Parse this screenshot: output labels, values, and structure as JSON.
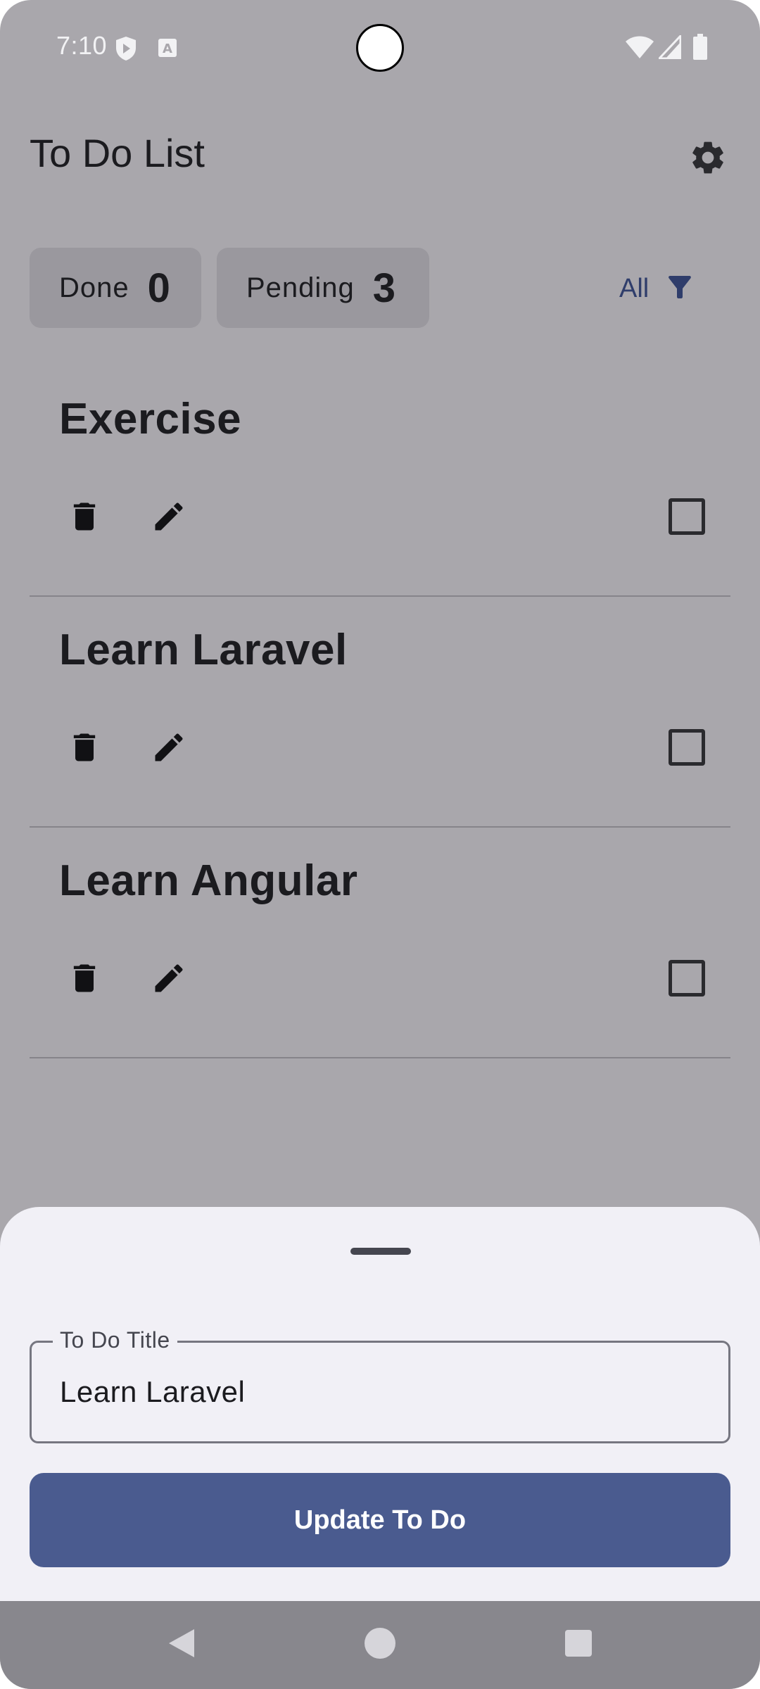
{
  "status_bar": {
    "time": "7:10",
    "icons": [
      "shield-play-icon",
      "text-a-icon",
      "wifi-icon",
      "signal-icon",
      "battery-icon"
    ]
  },
  "app_bar": {
    "title": "To Do List",
    "settings_icon": "gear-icon"
  },
  "counters": {
    "done_label": "Done",
    "done_count": "0",
    "pending_label": "Pending",
    "pending_count": "3"
  },
  "filter": {
    "label": "All",
    "icon": "funnel-icon",
    "color": "#2f3d6b"
  },
  "todos": [
    {
      "title": "Exercise",
      "checked": false
    },
    {
      "title": "Learn Laravel",
      "checked": false
    },
    {
      "title": "Learn Angular",
      "checked": false
    }
  ],
  "sheet": {
    "field_label": "To Do Title",
    "field_value": "Learn Laravel",
    "button_label": "Update To Do",
    "button_color": "#4a5b8f"
  },
  "nav_bar": {
    "icons": [
      "back-icon",
      "home-icon",
      "recents-icon"
    ]
  }
}
